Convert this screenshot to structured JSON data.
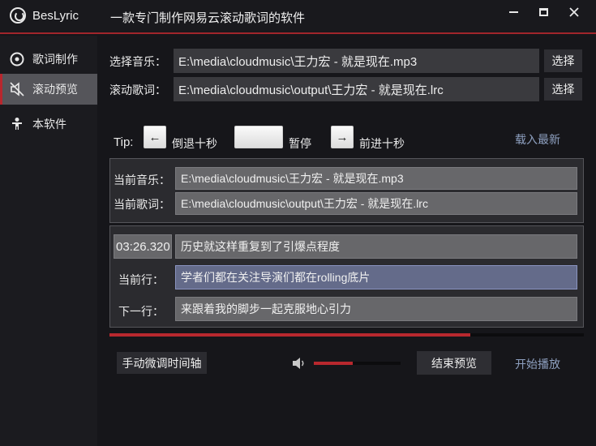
{
  "window": {
    "app_name": "BesLyric",
    "subtitle": "一款专门制作网易云滚动歌词的软件",
    "icons": [
      "app-logo-icon",
      "minimize-icon",
      "maximize-icon",
      "close-icon"
    ]
  },
  "sidebar": {
    "items": [
      {
        "label": "歌词制作",
        "icon": "record-icon",
        "active": false
      },
      {
        "label": "滚动预览",
        "icon": "mute-speaker-icon",
        "active": true
      },
      {
        "label": "本软件",
        "icon": "person-icon",
        "active": false
      }
    ]
  },
  "file_select": {
    "music_label": "选择音乐：",
    "music_path": "E:\\media\\cloudmusic\\王力宏 - 就是现在.mp3",
    "lyric_label": "滚动歌词：",
    "lyric_path": "E:\\media\\cloudmusic\\output\\王力宏 - 就是现在.lrc",
    "choose_label": "选择"
  },
  "tips": {
    "prefix": "Tip:",
    "back_key": "←",
    "back_label": "倒退十秒",
    "pause_label": "暂停",
    "forward_key": "→",
    "forward_label": "前进十秒",
    "load_latest": "载入最新"
  },
  "current": {
    "music_label": "当前音乐：",
    "music_path": "E:\\media\\cloudmusic\\王力宏 - 就是现在.mp3",
    "lyric_label": "当前歌词：",
    "lyric_path": "E:\\media\\cloudmusic\\output\\王力宏 - 就是现在.lrc"
  },
  "lyrics": {
    "timestamp": "03:26.320",
    "previous_line": "历史就这样重复到了引爆点程度",
    "current_label": "当前行：",
    "current_line": "学者们都在关注导演们都在rolling底片",
    "next_label": "下一行：",
    "next_line": "来跟着我的脚步一起克服地心引力"
  },
  "playback": {
    "progress_fraction": 0.76,
    "volume_fraction": 0.45,
    "adjust_label": "手动微调时间轴",
    "end_preview_label": "结束预览",
    "start_play_label": "开始播放"
  },
  "colors": {
    "accent": "#b8282e",
    "link": "#8ea0c0",
    "highlight_row": "#646b8a"
  }
}
